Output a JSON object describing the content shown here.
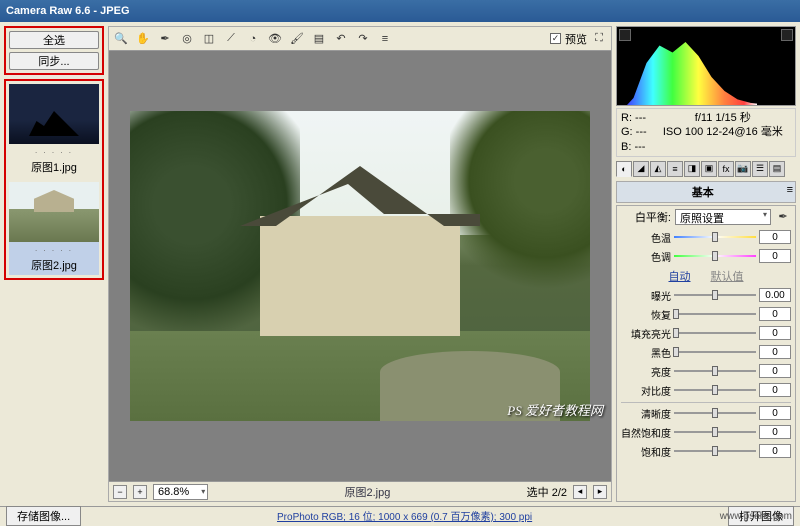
{
  "title": "Camera Raw 6.6  -  JPEG",
  "leftButtons": {
    "selectAll": "全选",
    "sync": "同步..."
  },
  "thumbs": [
    {
      "label": "原图1.jpg"
    },
    {
      "label": "原图2.jpg"
    }
  ],
  "toolbar": {
    "tools": [
      "zoom",
      "hand",
      "eyedropper",
      "sampler",
      "crop",
      "straighten",
      "spot",
      "redeye",
      "adjust",
      "grad",
      "radial",
      "rotate-ccw",
      "rotate-cw",
      "prefs"
    ],
    "previewChecked": true,
    "previewLabel": "预览"
  },
  "status": {
    "zoom": "68.8%",
    "filename": "原图2.jpg",
    "counter": "选中 2/2"
  },
  "info": {
    "r": "R:  ---",
    "g": "G:  ---",
    "b": "B:  ---",
    "aperture": "f/11  1/15 秒",
    "iso": "ISO 100  12-24@16 毫米"
  },
  "panel": {
    "title": "基本",
    "wbLabel": "白平衡:",
    "wbValue": "原照设置",
    "autoLabel": "自动",
    "defaultLabel": "默认值",
    "sliders": {
      "temp": {
        "label": "色温",
        "val": "0"
      },
      "tint": {
        "label": "色调",
        "val": "0"
      },
      "exposure": {
        "label": "曝光",
        "val": "0.00"
      },
      "recovery": {
        "label": "恢复",
        "val": "0"
      },
      "fill": {
        "label": "填充亮光",
        "val": "0"
      },
      "black": {
        "label": "黑色",
        "val": "0"
      },
      "bright": {
        "label": "亮度",
        "val": "0"
      },
      "contrast": {
        "label": "对比度",
        "val": "0"
      },
      "clarity": {
        "label": "清晰度",
        "val": "0"
      },
      "vibrance": {
        "label": "自然饱和度",
        "val": "0"
      },
      "sat": {
        "label": "饱和度",
        "val": "0"
      }
    }
  },
  "bottom": {
    "saveImage": "存储图像...",
    "profile": "ProPhoto RGB; 16 位; 1000 x 669 (0.7 百万像素); 300 ppi",
    "openImage": "打开图像"
  },
  "watermark": "PS 爱好者教程网",
  "watermark2": "www.psahz.com"
}
